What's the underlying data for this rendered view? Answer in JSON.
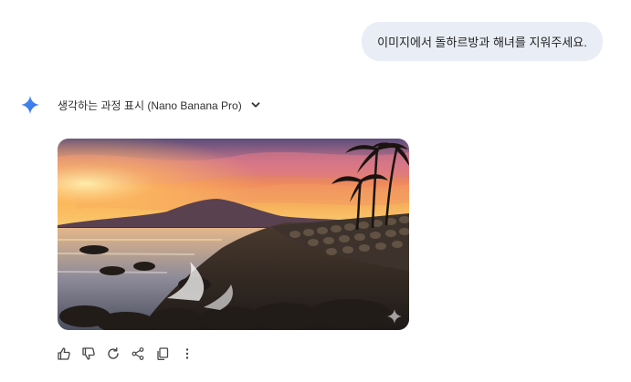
{
  "chat": {
    "user_message": "이미지에서 돌하르방과 해녀를 지워주세요.",
    "thinking_label": "생각하는 과정 표시 (Nano Banana Pro)"
  },
  "icons": {
    "assistant": "gemini-spark-icon",
    "expand": "chevron-down-icon",
    "image_overlay": "sparkle-watermark-icon",
    "actions": [
      "thumbs-up-icon",
      "thumbs-down-icon",
      "regenerate-icon",
      "share-icon",
      "copy-icon",
      "more-vert-icon"
    ]
  },
  "image": {
    "subject": "sunset coastline with volcanic rocks, stone wall and palm trees"
  },
  "colors": {
    "bubble": "#e9eef6",
    "accent_blue": "#4285f4",
    "icon_gray": "#444746"
  }
}
